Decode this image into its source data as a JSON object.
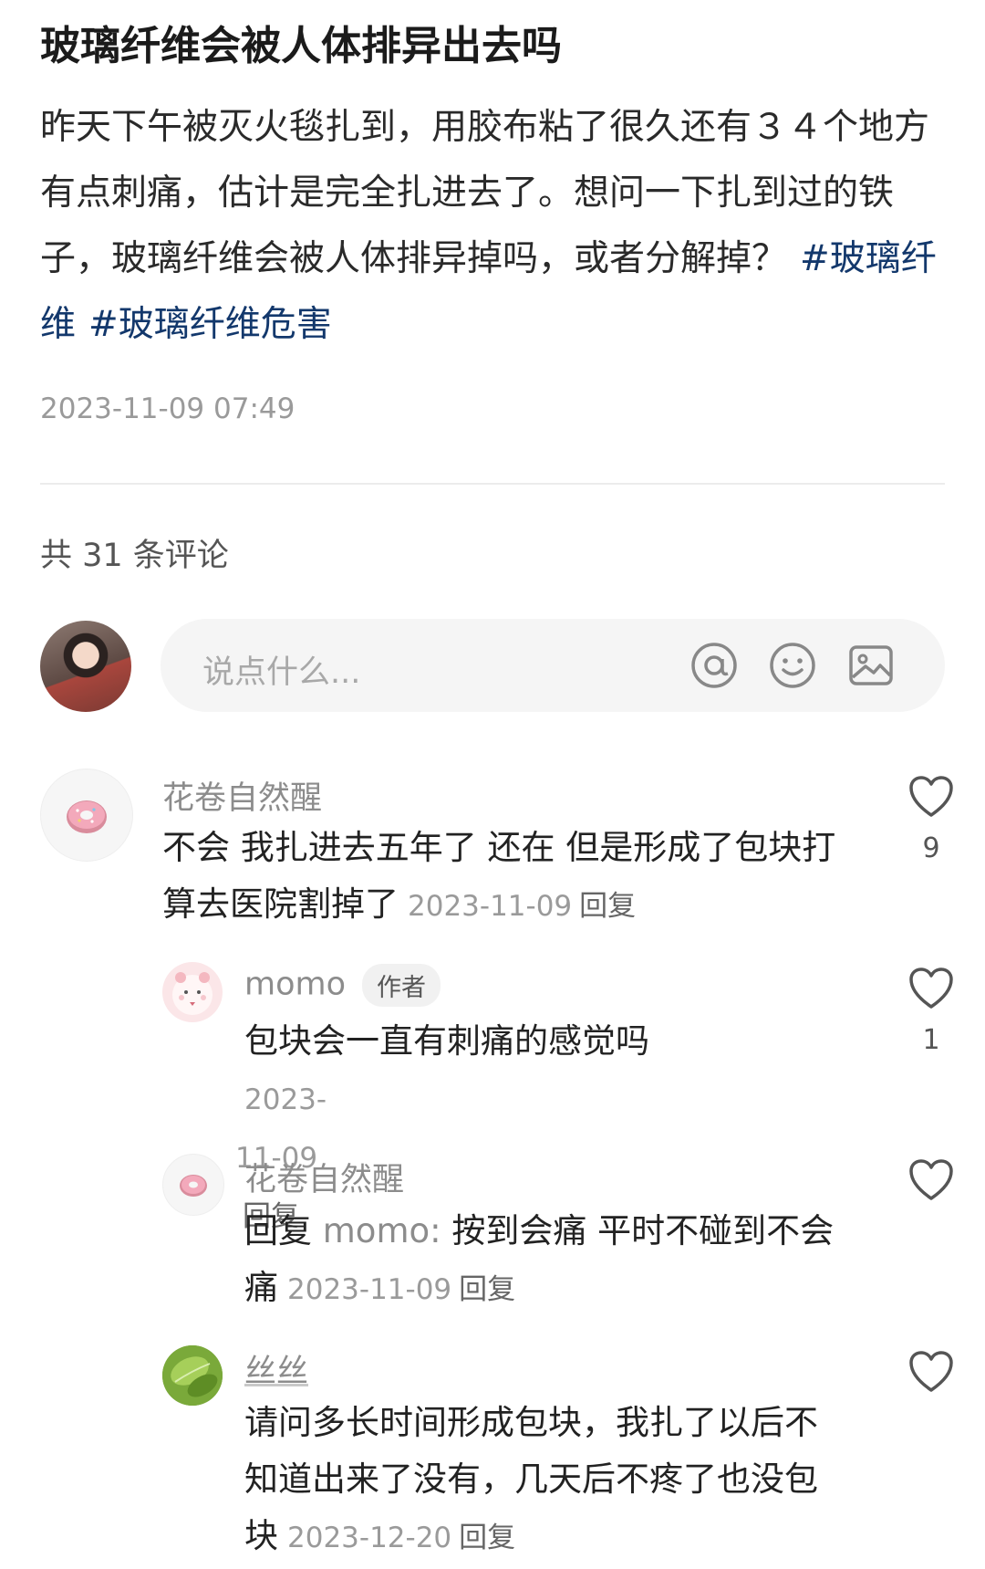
{
  "post": {
    "title": "玻璃纤维会被人体排异出去吗",
    "body": "昨天下午被灭火毯扎到，用胶布粘了很久还有３４个地方有点刺痛，估计是完全扎进去了。想问一下扎到过的铁子，玻璃纤维会被人体排异掉吗，或者分解掉？",
    "hashtags": [
      "#玻璃纤维",
      "#玻璃纤维危害"
    ],
    "date": "2023-11-09 07:49"
  },
  "comments_header": "共 31 条评论",
  "input": {
    "placeholder": "说点什么...",
    "icons": [
      "at-icon",
      "emoji-icon",
      "image-icon"
    ]
  },
  "comments": [
    {
      "user": "花卷自然醒",
      "avatar_icon": "donut-icon",
      "text": "不会 我扎进去五年了 还在 但是形成了包块打算去医院割掉了",
      "date": "2023-11-09",
      "reply": "回复",
      "likes": "9"
    },
    {
      "user": "momo",
      "badge": "作者",
      "avatar_icon": "pink-bear-icon",
      "text": "包块会一直有刺痛的感觉吗",
      "date": "2023-11-09",
      "reply": "回复",
      "likes": "1"
    },
    {
      "user": "花卷自然醒",
      "avatar_icon": "donut-icon",
      "reply_prefix": "回复",
      "reply_to": "momo:",
      "text": " 按到会痛 平时不碰到不会痛",
      "date": "2023-11-09",
      "reply": "回复",
      "likes": ""
    },
    {
      "user": "丝丝",
      "avatar_icon": "leaf-icon",
      "text": "请问多长时间形成包块，我扎了以后不知道出来了没有，几天后不疼了也没包块",
      "date": "2023-12-20",
      "reply": "回复",
      "likes": ""
    }
  ],
  "colors": {
    "hashtag": "#13386c",
    "muted_text": "#9a9a9a",
    "input_bg": "#f5f5f5"
  }
}
